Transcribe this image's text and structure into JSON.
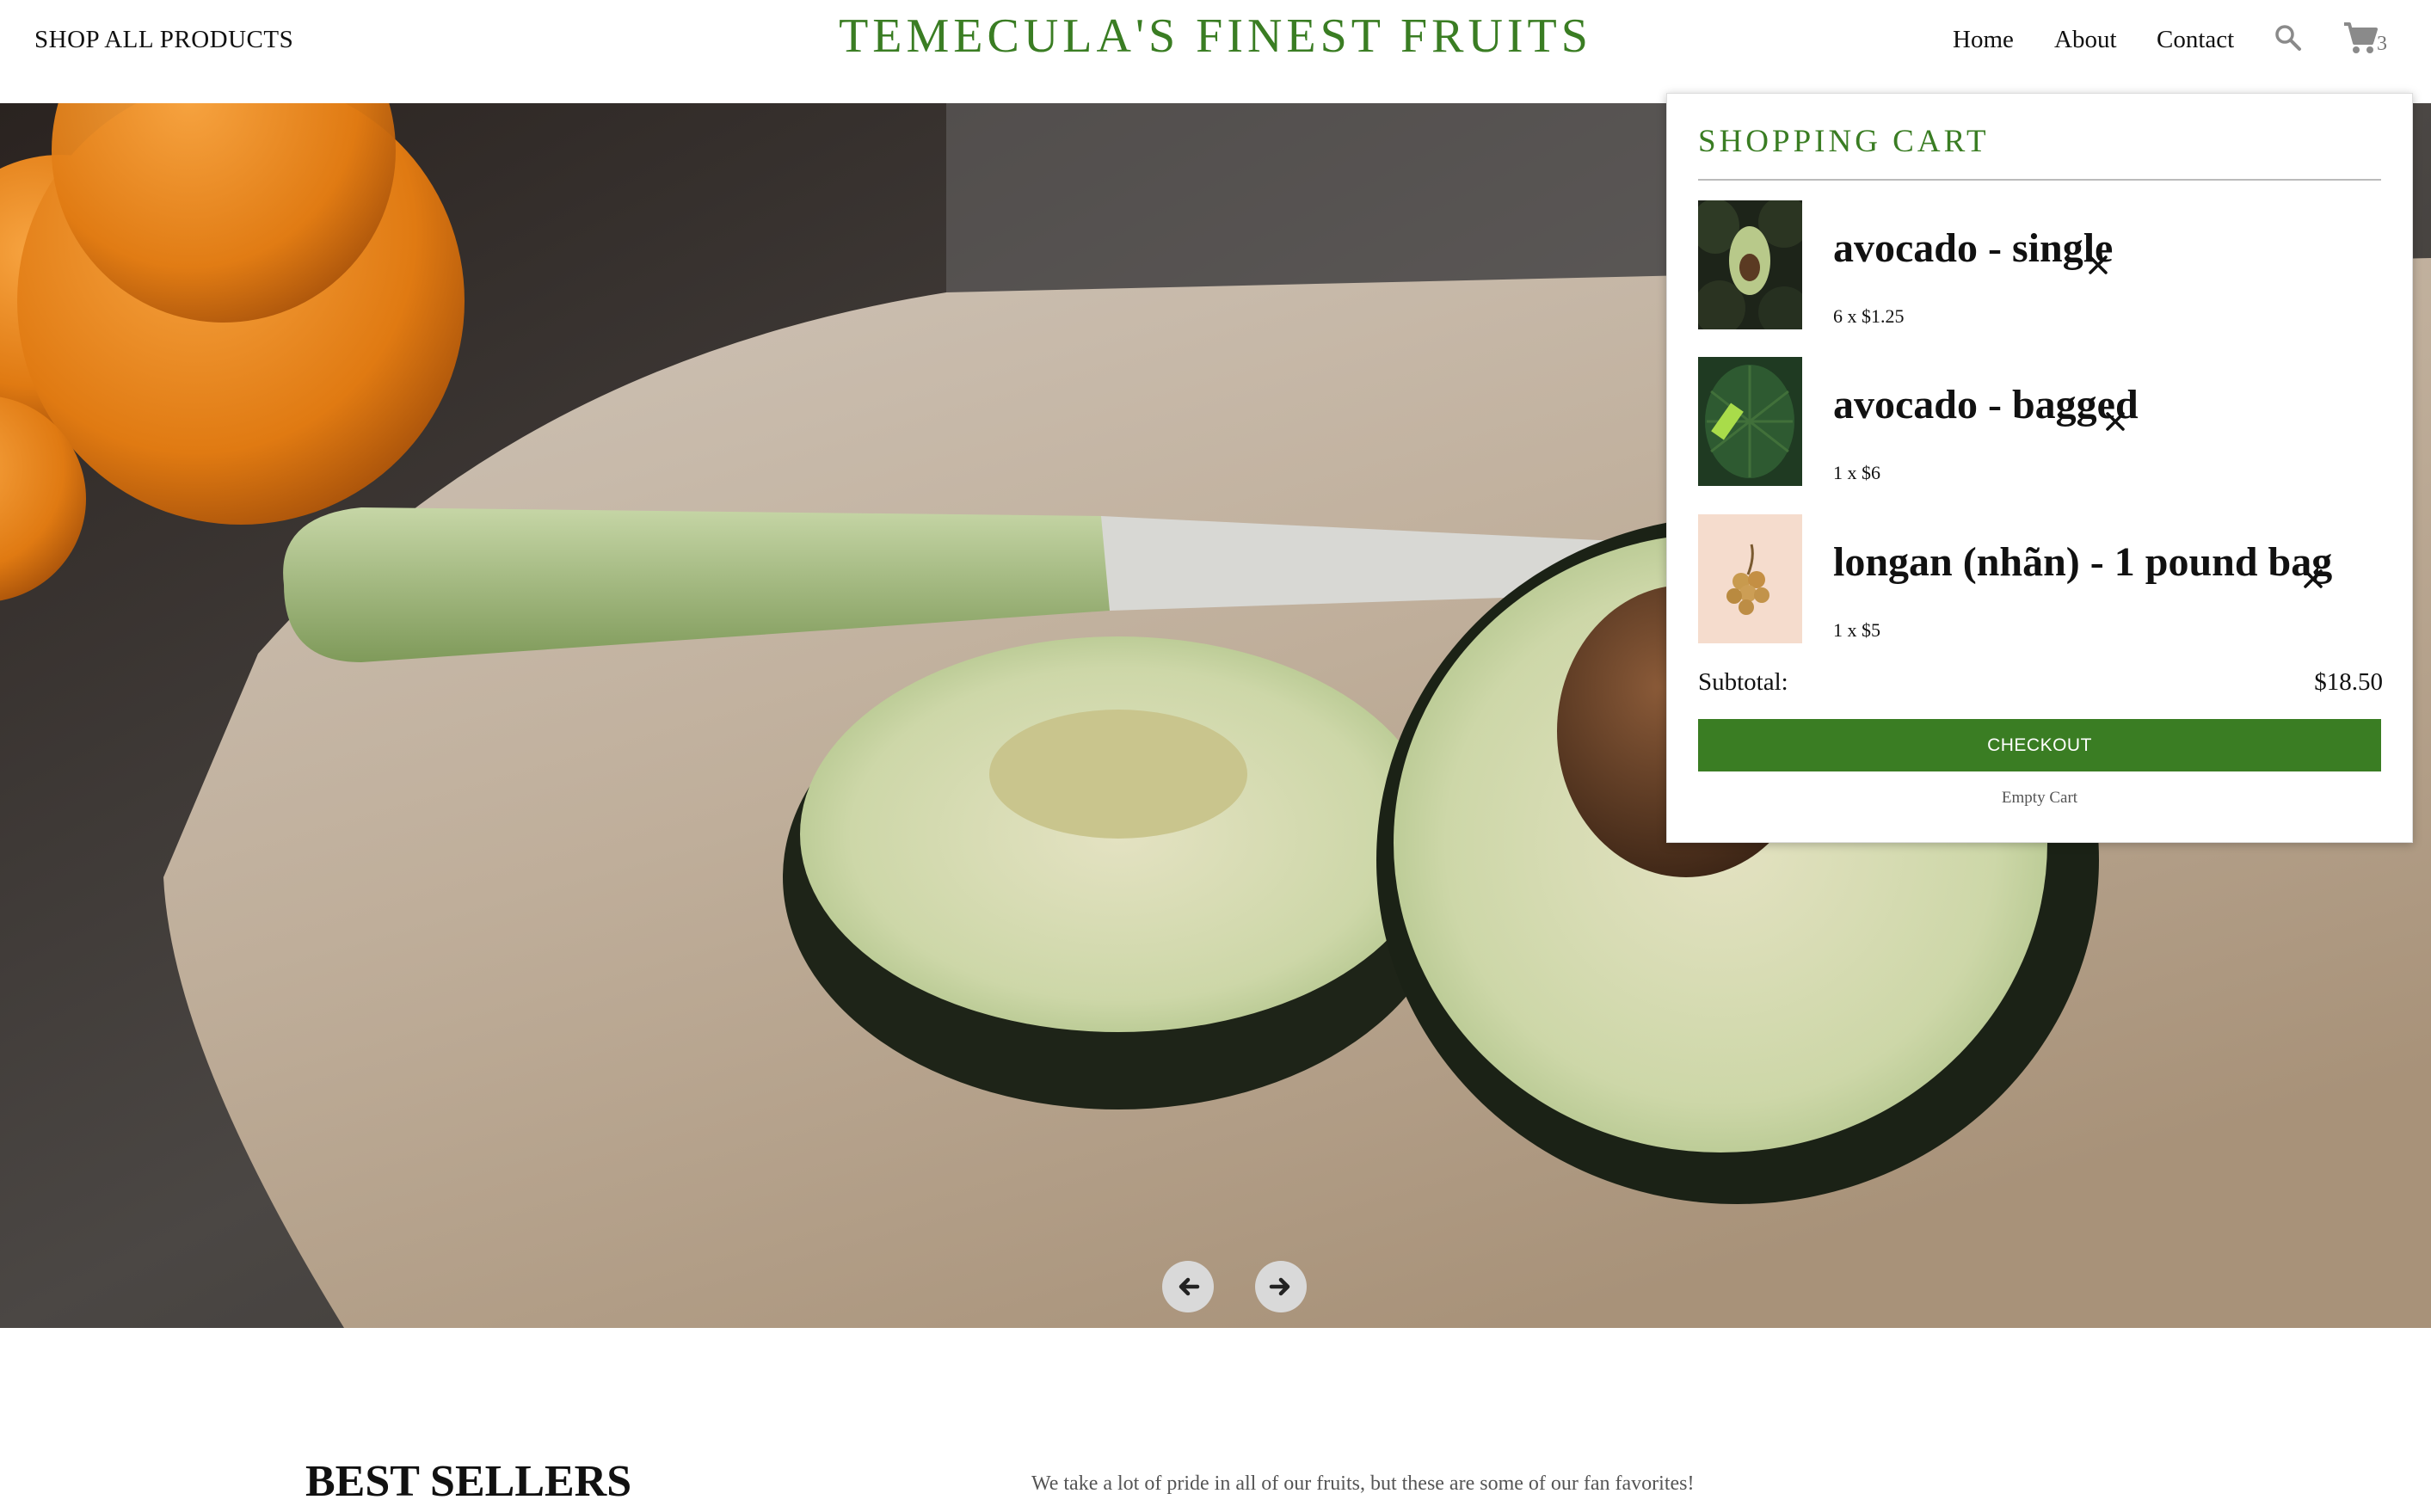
{
  "header": {
    "shop_all": "SHOP ALL PRODUCTS",
    "brand": "TEMECULA'S FINEST FRUITS",
    "nav": {
      "home": "Home",
      "about": "About",
      "contact": "Contact"
    },
    "search_icon": "search-icon",
    "cart_icon": "cart-icon",
    "cart_count": "3"
  },
  "hero": {
    "prev_icon": "arrow-left-icon",
    "next_icon": "arrow-right-icon"
  },
  "cart": {
    "title": "SHOPPING CART",
    "items": [
      {
        "name": "avocado - single",
        "qty": "6 x $1.25"
      },
      {
        "name": "avocado - bagged",
        "qty": "1 x $6"
      },
      {
        "name": "longan (nhãn) - 1 pound bag",
        "qty": "1 x $5"
      }
    ],
    "subtotal_label": "Subtotal:",
    "subtotal_value": "$18.50",
    "checkout_label": "CHECKOUT",
    "empty_cart_label": "Empty Cart"
  },
  "best_sellers": {
    "title": "BEST SELLERS",
    "description": "We take a lot of pride in all of our fruits, but these are some of our fan favorites!"
  },
  "colors": {
    "brand_green": "#3a7d23"
  }
}
